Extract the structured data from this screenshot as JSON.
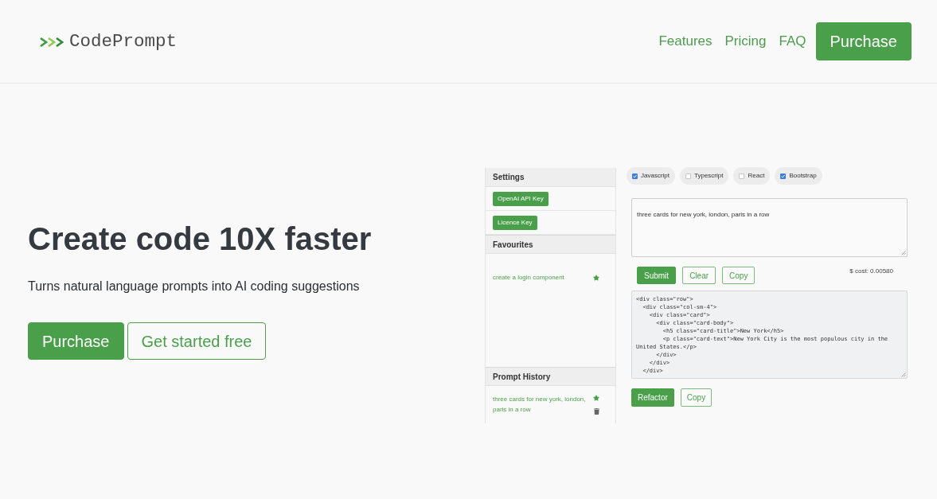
{
  "header": {
    "logo": "CodePrompt",
    "nav_links": [
      {
        "label": "Features"
      },
      {
        "label": "Pricing"
      },
      {
        "label": "FAQ"
      }
    ],
    "purchase_button": "Purchase"
  },
  "hero": {
    "title": "Create code 10X faster",
    "subtitle": "Turns natural language prompts into AI coding suggestions",
    "buttons": [
      {
        "label": "Purchase",
        "kind": "primary"
      },
      {
        "label": "Get started free",
        "kind": "outline"
      }
    ]
  },
  "app_preview": {
    "sidebar": [
      {
        "title": "Settings",
        "kind": "buttons",
        "items": [
          {
            "label": "OpenAI API Key"
          },
          {
            "label": "Licence Key"
          }
        ]
      },
      {
        "title": "Favourites",
        "kind": "favourites",
        "items": [
          {
            "text": "create a login component",
            "starred": true
          }
        ]
      },
      {
        "title": "Prompt History",
        "kind": "history",
        "items": [
          {
            "text": "three cards for new york, london, paris in a row",
            "starred": true
          }
        ]
      }
    ],
    "options": [
      {
        "label": "Javascript",
        "checked": true
      },
      {
        "label": "Typescript",
        "checked": false
      },
      {
        "label": "React",
        "checked": false
      },
      {
        "label": "Bootstrap",
        "checked": true
      }
    ],
    "prompt": {
      "value": "three cards for new york, london, paris in a row"
    },
    "prompt_actions": [
      {
        "label": "Submit",
        "kind": "primary"
      },
      {
        "label": "Clear",
        "kind": "outline"
      },
      {
        "label": "Copy",
        "kind": "outline"
      }
    ],
    "cost": "$ cost: 0.00580",
    "code_output": {
      "lines": [
        "<div class=\"row\">",
        "  <div class=\"col-sm-4\">",
        "    <div class=\"card\">",
        "      <div class=\"card-body\">",
        "        <h5 class=\"card-title\">New York</h5>",
        "        <p class=\"card-text\">New York City is the most populous city in the United States.</p>",
        "      </div>",
        "    </div>",
        "  </div>"
      ]
    },
    "code_actions": [
      {
        "label": "Refactor",
        "kind": "primary"
      },
      {
        "label": "Copy",
        "kind": "outline"
      }
    ]
  }
}
